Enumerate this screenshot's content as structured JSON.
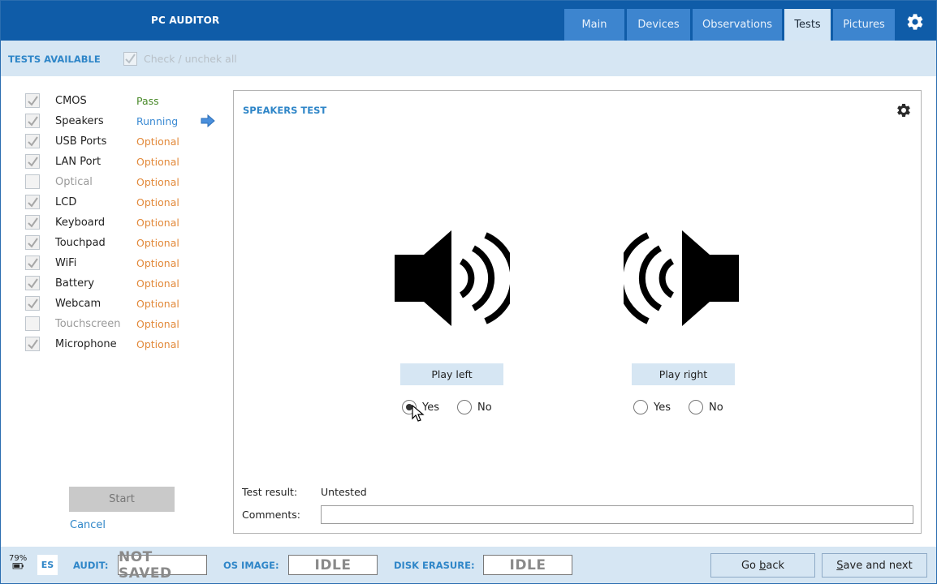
{
  "header": {
    "title": "PC AUDITOR",
    "tabs": [
      {
        "label": "Main",
        "active": false
      },
      {
        "label": "Devices",
        "active": false
      },
      {
        "label": "Observations",
        "active": false
      },
      {
        "label": "Tests",
        "active": true
      },
      {
        "label": "Pictures",
        "active": false
      }
    ],
    "settings_icon": "gear-icon"
  },
  "subheader": {
    "title": "TESTS AVAILABLE",
    "check_all_label": "Check / unchek all",
    "check_all_checked": true
  },
  "tests": [
    {
      "name": "CMOS",
      "status": "Pass",
      "checked": true
    },
    {
      "name": "Speakers",
      "status": "Running",
      "checked": true
    },
    {
      "name": "USB Ports",
      "status": "Optional",
      "checked": true
    },
    {
      "name": "LAN Port",
      "status": "Optional",
      "checked": true
    },
    {
      "name": "Optical",
      "status": "Optional",
      "checked": false
    },
    {
      "name": "LCD",
      "status": "Optional",
      "checked": true
    },
    {
      "name": "Keyboard",
      "status": "Optional",
      "checked": true
    },
    {
      "name": "Touchpad",
      "status": "Optional",
      "checked": true
    },
    {
      "name": "WiFi",
      "status": "Optional",
      "checked": true
    },
    {
      "name": "Battery",
      "status": "Optional",
      "checked": true
    },
    {
      "name": "Webcam",
      "status": "Optional",
      "checked": true
    },
    {
      "name": "Touchscreen",
      "status": "Optional",
      "checked": false
    },
    {
      "name": "Microphone",
      "status": "Optional",
      "checked": true
    }
  ],
  "actions": {
    "start_label": "Start",
    "cancel_label": "Cancel"
  },
  "panel": {
    "title": "SPEAKERS TEST",
    "play_left_label": "Play left",
    "play_right_label": "Play right",
    "left_yes_label": "Yes",
    "left_no_label": "No",
    "right_yes_label": "Yes",
    "right_no_label": "No",
    "left_selected": "Yes",
    "right_selected": "",
    "test_result_label": "Test result:",
    "test_result_value": "Untested",
    "comments_label": "Comments:",
    "comments_value": ""
  },
  "footer": {
    "battery_percent": "79%",
    "language": "ES",
    "audit_label": "AUDIT:",
    "audit_status": "NOT SAVED",
    "os_image_label": "OS IMAGE:",
    "os_image_status": "IDLE",
    "disk_erasure_label": "DISK ERASURE:",
    "disk_erasure_status": "IDLE",
    "go_back_pre": "Go ",
    "go_back_u": "b",
    "go_back_post": "ack",
    "save_next_u": "S",
    "save_next_post": "ave and next"
  },
  "colors": {
    "header_bg": "#0f5ca8",
    "accent": "#2f86c8",
    "pass": "#4a8a2a",
    "running": "#3b8ad3",
    "optional": "#e2893a"
  }
}
